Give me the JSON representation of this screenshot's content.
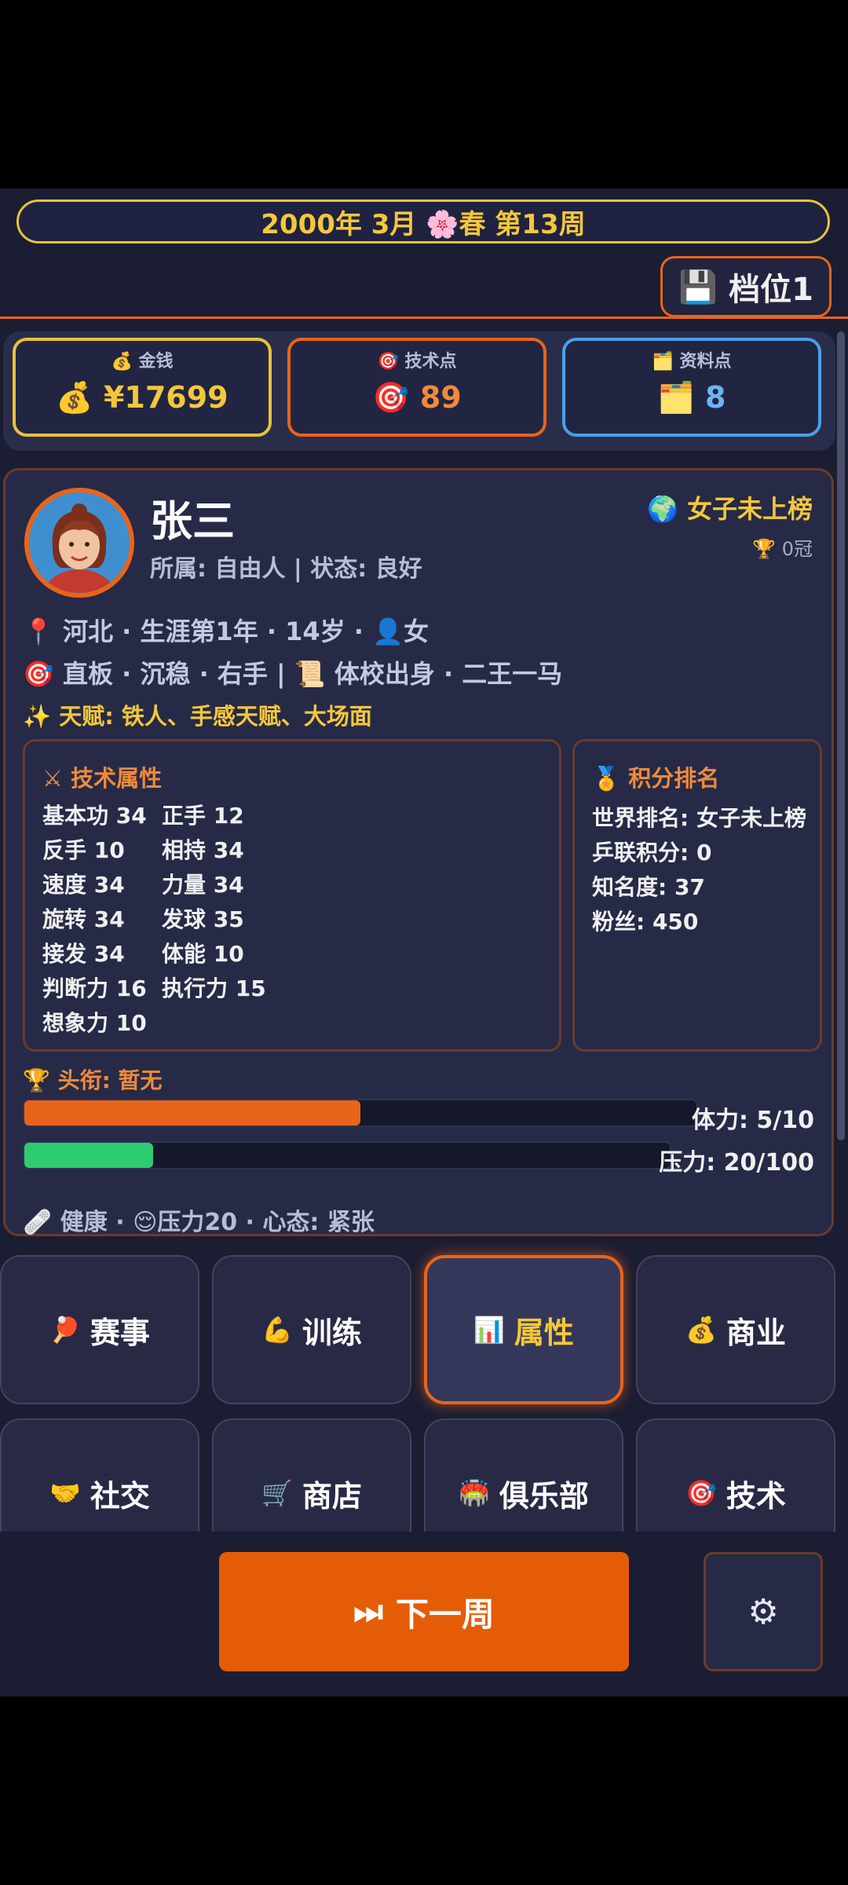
{
  "header": {
    "date_text": "2000年 3月 🌸春 第13周",
    "save_icon": "💾",
    "save_label": "档位1"
  },
  "resources": {
    "money": {
      "label": "💰 金钱",
      "value": "💰 ¥17699",
      "color": "#e8c23a",
      "value_color": "#f4c73b"
    },
    "tech_points": {
      "label": "🎯 技术点",
      "value": "🎯 89",
      "color": "#e8641a",
      "value_color": "#f08a3a"
    },
    "data_points": {
      "label": "🗂️ 资料点",
      "value": "🗂️ 8",
      "color": "#4a9fe8",
      "value_color": "#6cb4f5"
    }
  },
  "profile": {
    "name": "张三",
    "affiliation": "所属: 自由人 | 状态: 良好",
    "rank_status": "🌍 女子未上榜",
    "titles": "🏆 0冠",
    "line1": "📍 河北 · 生涯第1年 · 14岁 · 👤女",
    "line2": "🎯 直板 · 沉稳 · 右手 | 📜 体校出身 · 二王一马",
    "talent": "✨ 天赋: 铁人、手感天赋、大场面"
  },
  "attributes": {
    "title": "⚔ 技术属性",
    "items": [
      "基本功 34",
      "正手 12",
      "反手 10",
      "相持 34",
      "速度 34",
      "力量 34",
      "旋转 34",
      "发球 35",
      "接发 34",
      "体能 10",
      "判断力 16",
      "执行力 15",
      "想象力 10"
    ]
  },
  "ranking": {
    "title": "🏅 积分排名",
    "items": [
      "世界排名: 女子未上榜",
      "乒联积分: 0",
      "知名度: 37",
      "粉丝: 450"
    ]
  },
  "honor": "🏆 头衔: 暂无",
  "stamina": {
    "label": "体力: 5/10",
    "value": 5,
    "max": 10,
    "color": "#e8641a"
  },
  "pressure": {
    "label": "压力: 20/100",
    "value": 20,
    "max": 100,
    "color": "#2ecc71"
  },
  "health_line": "🩹 健康 · 😌压力20 · 心态: 紧张",
  "nav": [
    {
      "icon": "🏓",
      "label": "赛事"
    },
    {
      "icon": "💪",
      "label": "训练"
    },
    {
      "icon": "📊",
      "label": "属性"
    },
    {
      "icon": "💰",
      "label": "商业"
    },
    {
      "icon": "🤝",
      "label": "社交"
    },
    {
      "icon": "🛒",
      "label": "商店"
    },
    {
      "icon": "🏟️",
      "label": "俱乐部"
    },
    {
      "icon": "🎯",
      "label": "技术"
    }
  ],
  "next_week": {
    "icon": "⏭",
    "label": "下一周"
  },
  "settings_icon": "⚙"
}
